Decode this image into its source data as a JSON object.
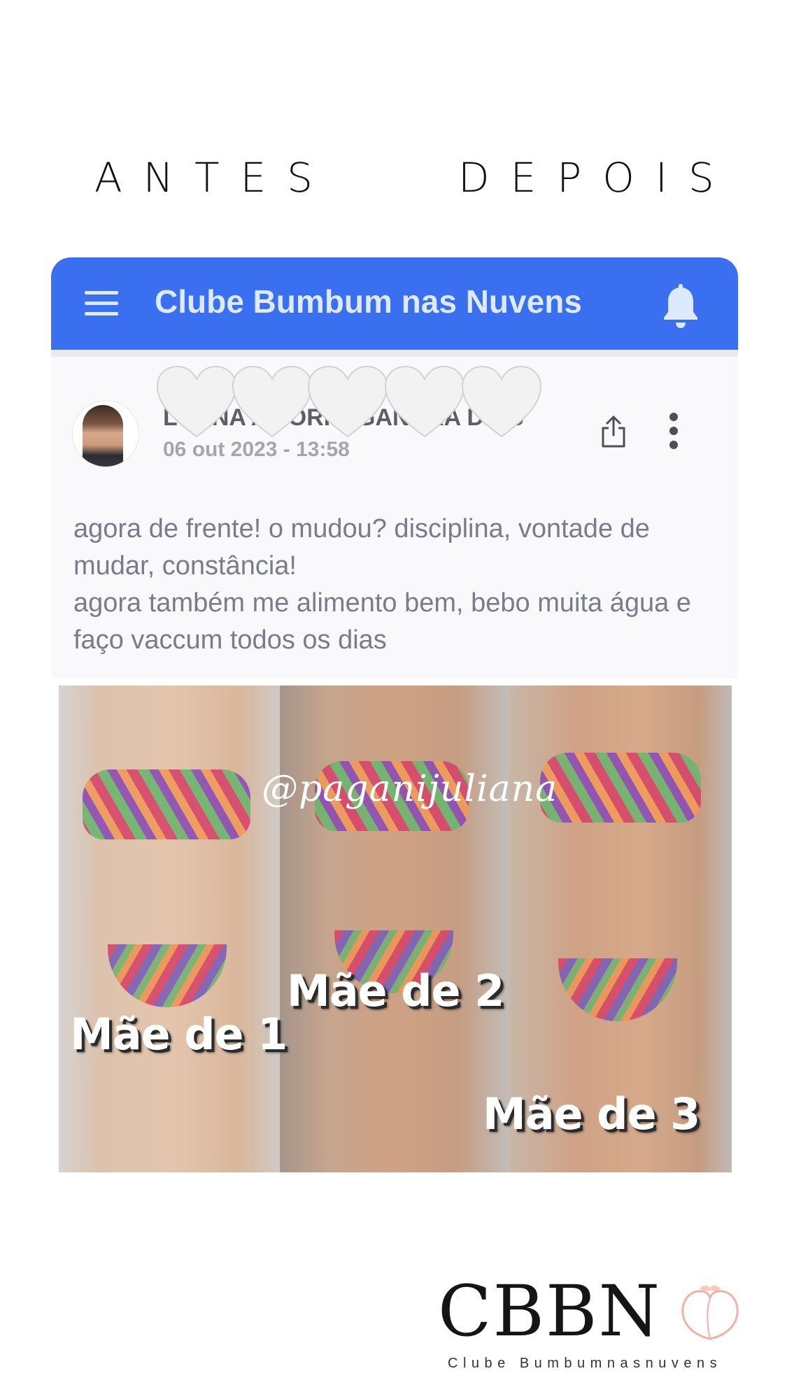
{
  "headline": {
    "antes": "ANTES",
    "depois": "DEPOIS"
  },
  "app": {
    "title": "Clube Bumbum nas Nuvens",
    "accent_color": "#3a6fef",
    "menu_icon": "hamburger-menu-icon",
    "notification_icon": "bell-icon"
  },
  "post": {
    "author": "LUANA AMORIM GANDRA DIAS",
    "date": "06 out 2023 - 13:58",
    "share_icon": "share-icon",
    "more_icon": "more-vertical-icon",
    "reactions_overlay": "white-hearts",
    "body_lines": [
      "agora de frente! o mudou? disciplina, vontade de mudar, constância!",
      "agora também me alimento bem, bebo muita água e faço vaccum todos os dias"
    ]
  },
  "photo": {
    "watermark": "@paganijuliana",
    "captions": [
      "Mãe de 1",
      "Mãe de 2",
      "Mãe de 3"
    ]
  },
  "logo": {
    "mark": "CBBN",
    "tagline": "Clube Bumbumnasnuvens"
  }
}
